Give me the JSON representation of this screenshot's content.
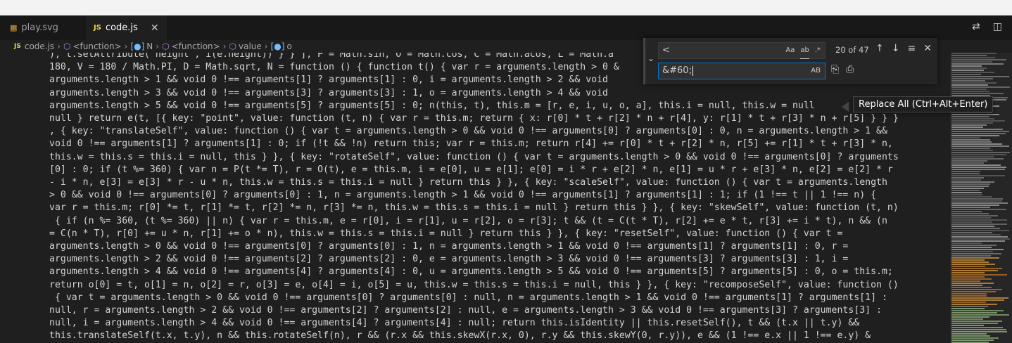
{
  "tabs": [
    {
      "label": "play.svg",
      "icon": "svg-file-icon",
      "active": false
    },
    {
      "label": "code.js",
      "icon": "js-file-icon",
      "active": true
    }
  ],
  "tab_close_glyph": "✕",
  "editor_actions": {
    "split_icon": "split-editor-icon",
    "compare_icon": "open-changes-icon"
  },
  "breadcrumb": [
    {
      "label": "code.js",
      "icon": "JS"
    },
    {
      "label": "<function>",
      "icon": "function-icon"
    },
    {
      "label": "N",
      "icon": "variable-icon"
    },
    {
      "label": "<function>",
      "icon": "function-icon"
    },
    {
      "label": "value",
      "icon": "function-icon"
    },
    {
      "label": "o",
      "icon": "variable-icon"
    }
  ],
  "find_widget": {
    "find_value": "<",
    "replace_value": "&#60;",
    "match_case": "Aa",
    "whole_word": "ab",
    "regex": ".*",
    "preserve_case": "AB",
    "result_count": "20 of 47"
  },
  "tooltip": "Replace All (Ctrl+Alt+Enter)",
  "code_lines": [
    "), t.setAttribute(\"height\", i(e.height)) } } ], P = Math.sin, O = Math.cos, C = Math.acos, L = Math.a",
    "180, V = 180 / Math.PI, D = Math.sqrt, N = function () { function t() { var r = arguments.length > 0 &",
    "arguments.length > 1 && void 0 !== arguments[1] ? arguments[1] : 0, i = arguments.length > 2 && void ",
    "arguments.length > 3 && void 0 !== arguments[3] ? arguments[3] : 1, o = arguments.length > 4 && void ",
    "arguments.length > 5 && void 0 !== arguments[5] ? arguments[5] : 0; n(this, t), this.m = [r, e, i, u, o, a], this.i = null, this.w = null",
    "null } return e(t, [{ key: \"point\", value: function (t, n) { var r = this.m; return { x: r[0] * t + r[2] * n + r[4], y: r[1] * t + r[3] * n + r[5] } } }",
    ", { key: \"translateSelf\", value: function () { var t = arguments.length > 0 && void 0 !== arguments[0] ? arguments[0] : 0, n = arguments.length > 1 &&",
    "void 0 !== arguments[1] ? arguments[1] : 0; if (!t && !n) return this; var r = this.m; return r[4] += r[0] * t + r[2] * n, r[5] += r[1] * t + r[3] * n,",
    "this.w = this.s = this.i = null, this } }, { key: \"rotateSelf\", value: function () { var t = arguments.length > 0 && void 0 !== arguments[0] ? arguments",
    "[0] : 0; if (t %= 360) { var n = P(t *= T), r = O(t), e = this.m, i = e[0], u = e[1]; e[0] = i * r + e[2] * n, e[1] = u * r + e[3] * n, e[2] = e[2] * r",
    "- i * n, e[3] = e[3] * r - u * n, this.w = this.s = this.i = null } return this } }, { key: \"scaleSelf\", value: function () { var t = arguments.length",
    "> 0 && void 0 !== arguments[0] ? arguments[0] : 1, n = arguments.length > 1 && void 0 !== arguments[1] ? arguments[1] : 1; if (1 !== t || 1 !== n) {",
    "var r = this.m; r[0] *= t, r[1] *= t, r[2] *= n, r[3] *= n, this.w = this.s = this.i = null } return this } }, { key: \"skewSelf\", value: function (t, n)",
    " { if (n %= 360, (t %= 360) || n) { var r = this.m, e = r[0], i = r[1], u = r[2], o = r[3]; t && (t = C(t * T), r[2] += e * t, r[3] += i * t), n && (n",
    "= C(n * T), r[0] += u * n, r[1] += o * n), this.w = this.s = this.i = null } return this } }, { key: \"resetSelf\", value: function () { var t =",
    "arguments.length > 0 && void 0 !== arguments[0] ? arguments[0] : 1, n = arguments.length > 1 && void 0 !== arguments[1] ? arguments[1] : 0, r =",
    "arguments.length > 2 && void 0 !== arguments[2] ? arguments[2] : 0, e = arguments.length > 3 && void 0 !== arguments[3] ? arguments[3] : 1, i =",
    "arguments.length > 4 && void 0 !== arguments[4] ? arguments[4] : 0, u = arguments.length > 5 && void 0 !== arguments[5] ? arguments[5] : 0, o = this.m;",
    "return o[0] = t, o[1] = n, o[2] = r, o[3] = e, o[4] = i, o[5] = u, this.w = this.s = this.i = null, this } }, { key: \"recomposeSelf\", value: function ()",
    " { var t = arguments.length > 0 && void 0 !== arguments[0] ? arguments[0] : null, n = arguments.length > 1 && void 0 !== arguments[1] ? arguments[1] :",
    "null, r = arguments.length > 2 && void 0 !== arguments[2] ? arguments[2] : null, e = arguments.length > 3 && void 0 !== arguments[3] ? arguments[3] :",
    "null, i = arguments.length > 4 && void 0 !== arguments[4] ? arguments[4] : null; return this.isIdentity || this.resetSelf(), t && (t.x || t.y) &&",
    "this.translateSelf(t.x, t.y), n && this.rotateSelf(n), r && (r.x && this.skewX(r.x, 0), r.y && this.skewY(0, r.y)), e && (1 !== e.x || 1 !== e.y) &"
  ],
  "colors": {
    "background": "#1f1f1f",
    "tab_bar": "#181818",
    "find_widget": "#252526",
    "focus_border": "#0078d4"
  }
}
